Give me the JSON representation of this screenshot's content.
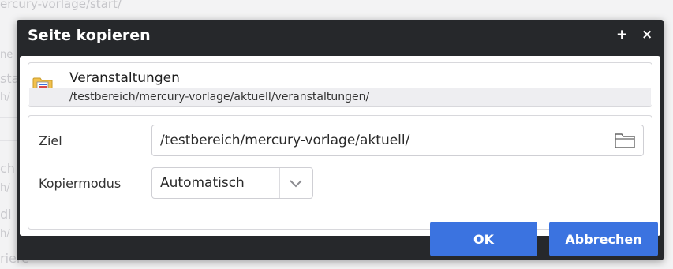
{
  "background": {
    "path": "ercury-vorlage/start/",
    "fragments": [
      "ne",
      "sta",
      "h/",
      "ch",
      "h/",
      "di",
      "h/",
      "riere"
    ]
  },
  "dialog": {
    "title": "Seite kopieren",
    "maximize_icon": "+",
    "close_icon": "×",
    "resource": {
      "name": "Veranstaltungen",
      "path": "/testbereich/mercury-vorlage/aktuell/veranstaltungen/",
      "icon": "folder-icon"
    },
    "form": {
      "target_label": "Ziel",
      "target_value": "/testbereich/mercury-vorlage/aktuell/",
      "copy_mode_label": "Kopiermodus",
      "copy_mode_value": "Automatisch"
    },
    "buttons": {
      "ok": "OK",
      "cancel": "Abbrechen"
    }
  },
  "colors": {
    "dialog_bg": "#26282b",
    "button": "#3b73e0"
  }
}
